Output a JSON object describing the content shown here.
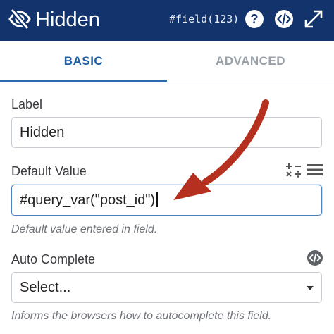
{
  "header": {
    "title": "Hidden",
    "field_id": "#field(123)"
  },
  "tabs": [
    {
      "label": "BASIC",
      "active": true
    },
    {
      "label": "ADVANCED",
      "active": false
    }
  ],
  "form": {
    "label_field": {
      "label": "Label",
      "value": "Hidden"
    },
    "default_value_field": {
      "label": "Default Value",
      "value": "#query_var(\"post_id\")",
      "help": "Default value entered in field."
    },
    "autocomplete_field": {
      "label": "Auto Complete",
      "selected": "Select...",
      "help": "Informs the browsers how to autocomplete this field."
    }
  },
  "colors": {
    "header_bg": "#12336b",
    "active_tab": "#1f5fa8",
    "annotation_arrow": "#b5301f"
  },
  "icons": [
    "eye-slash-icon",
    "help-icon",
    "code-icon",
    "expand-icon",
    "calculator-icon",
    "menu-icon",
    "code-icon"
  ]
}
